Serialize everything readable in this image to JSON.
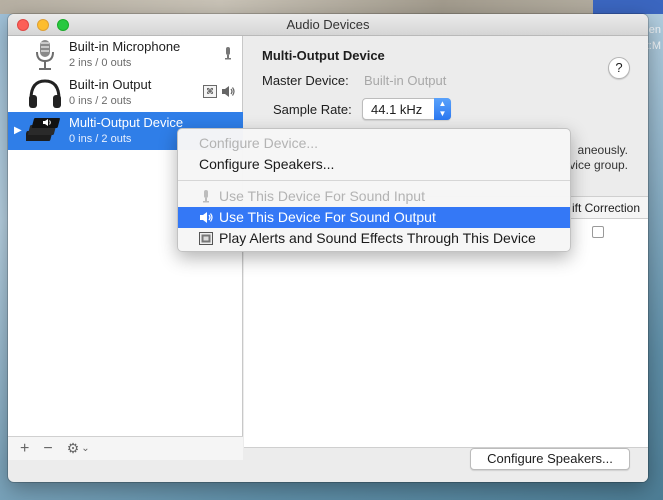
{
  "window": {
    "title": "Audio Devices"
  },
  "background": {
    "right_glyphs": [
      "en",
      "t:M"
    ]
  },
  "sidebar": {
    "devices": [
      {
        "name": "Built-in Microphone",
        "io": "2 ins / 0 outs",
        "icon": "microphone-icon",
        "selected": false
      },
      {
        "name": "Built-in Output",
        "io": "0 ins / 2 outs",
        "icon": "headphones-icon",
        "selected": false
      },
      {
        "name": "Multi-Output Device",
        "io": "0 ins / 2 outs",
        "icon": "multi-output-icon",
        "selected": true
      }
    ],
    "footer": {
      "add": "+",
      "remove": "−",
      "gear": "⚙",
      "chevron": "⌄"
    }
  },
  "detail": {
    "title": "Multi-Output Device",
    "help": "?",
    "master_label": "Master Device:",
    "master_value": "Built-in Output",
    "rate_label": "Sample Rate:",
    "rate_value": "44.1 kHz",
    "desc_line1": "aneously.",
    "desc_line2": "vice group.",
    "drift_header": "ift Correction",
    "configure_button": "Configure Speakers..."
  },
  "context_menu": {
    "items": [
      {
        "label": "Configure Device...",
        "disabled": true
      },
      {
        "label": "Configure Speakers...",
        "disabled": false
      },
      {
        "label": "Use This Device For Sound Input",
        "disabled": true,
        "icon": "microphone-icon"
      },
      {
        "label": "Use This Device For Sound Output",
        "disabled": false,
        "highlighted": true,
        "icon": "speaker-icon"
      },
      {
        "label": "Play Alerts and Sound Effects Through This Device",
        "disabled": false,
        "icon": "alert-icon"
      }
    ]
  },
  "colors": {
    "selection": "#2f7ee8",
    "menu_highlight": "#3478f6",
    "accent_popup": "#2b78f1"
  }
}
